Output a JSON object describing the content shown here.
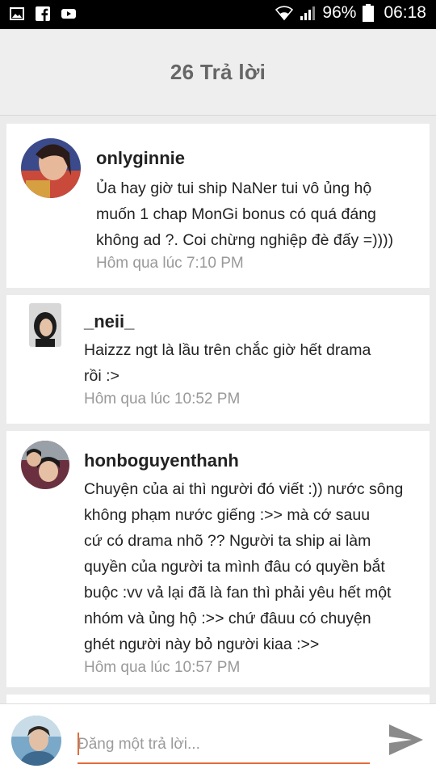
{
  "status_bar": {
    "battery": "96%",
    "time": "06:18",
    "icons": [
      "image-icon",
      "facebook-icon",
      "youtube-icon",
      "wifi-icon",
      "signal-icon",
      "battery-icon"
    ]
  },
  "header": {
    "title": "26 Trả lời"
  },
  "comments": [
    {
      "name": "onlyginnie",
      "text": "Ủa hay giờ tui ship NaNer tui vô ủng hộ\nmuốn 1 chap MonGi bonus có quá đáng\nkhông ad ?. Coi chừng nghiệp đè đấy =))))",
      "time": "Hôm qua lúc 7:10 PM"
    },
    {
      "name": "_neii_",
      "text": "Haizzz ngt là lầu trên chắc giờ hết drama\nrồi :>",
      "time": "Hôm qua lúc 10:52 PM"
    },
    {
      "name": "honboguyenthanh",
      "text": "Chuyện của ai thì người đó viết :)) nước sông\nkhông phạm nước giếng :>> mà cớ sauu\ncứ có drama nhõ ?? Người ta ship ai làm\nquyền của người ta mình đâu có quyền bắt\nbuộc :vv vả lại đã là fan thì phải yêu hết một\nnhóm và ủng hộ :>> chứ đâuu có chuyện\nghét người này bỏ người kiaa :>>",
      "time": "Hôm qua lúc 10:57 PM"
    }
  ],
  "composer": {
    "placeholder": "Đăng một trả lời..."
  },
  "colors": {
    "accent": "#e56b3a",
    "status_bar": "#000000",
    "background": "#ebebeb"
  }
}
